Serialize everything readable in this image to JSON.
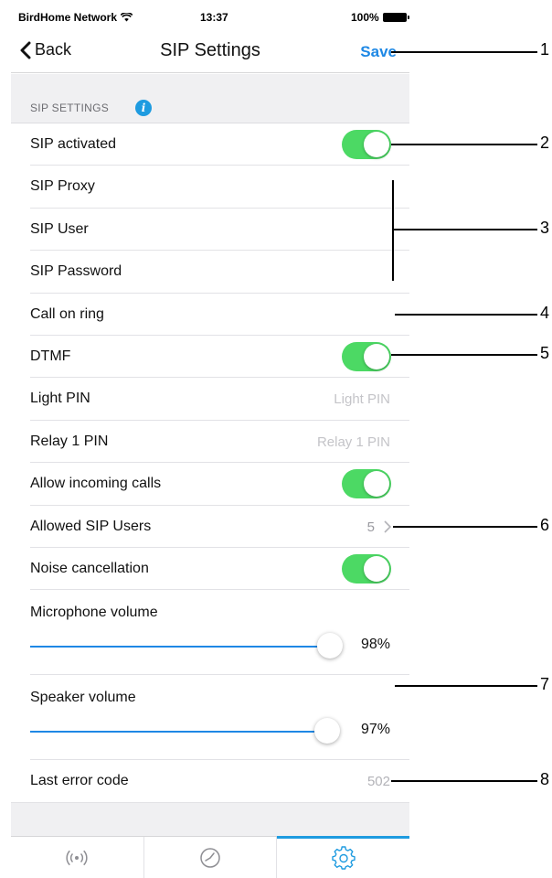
{
  "status_bar": {
    "carrier": "BirdHome Network",
    "time": "13:37",
    "battery": "100%"
  },
  "nav": {
    "back_label": "Back",
    "title": "SIP Settings",
    "save_label": "Save"
  },
  "section": {
    "header": "SIP SETTINGS",
    "info_glyph": "i"
  },
  "rows": {
    "sip_activated": {
      "label": "SIP activated",
      "on": true
    },
    "sip_proxy": {
      "label": "SIP Proxy"
    },
    "sip_user": {
      "label": "SIP User"
    },
    "sip_password": {
      "label": "SIP Password"
    },
    "call_on_ring": {
      "label": "Call on ring"
    },
    "dtmf": {
      "label": "DTMF",
      "on": true
    },
    "light_pin": {
      "label": "Light PIN",
      "placeholder": "Light PIN"
    },
    "relay1_pin": {
      "label": "Relay 1 PIN",
      "placeholder": "Relay 1 PIN"
    },
    "allow_incoming": {
      "label": "Allow incoming calls",
      "on": true
    },
    "allowed_sip_users": {
      "label": "Allowed SIP Users",
      "count": "5"
    },
    "noise_cancellation": {
      "label": "Noise cancellation",
      "on": true
    },
    "mic_volume": {
      "label": "Microphone volume",
      "value_text": "98%",
      "value": 0.98
    },
    "speaker_volume": {
      "label": "Speaker volume",
      "value_text": "97%",
      "value": 0.97
    },
    "last_error": {
      "label": "Last error code",
      "value": "502"
    }
  },
  "tabs": [
    {
      "icon": "broadcast-icon",
      "active": false
    },
    {
      "icon": "clock-icon",
      "active": false
    },
    {
      "icon": "gear-icon",
      "active": true
    }
  ],
  "callouts": [
    "1",
    "2",
    "3",
    "4",
    "5",
    "6",
    "7",
    "8"
  ],
  "colors": {
    "accent": "#1e88e5",
    "toggle_on": "#4cd964",
    "info": "#1e9be0"
  }
}
